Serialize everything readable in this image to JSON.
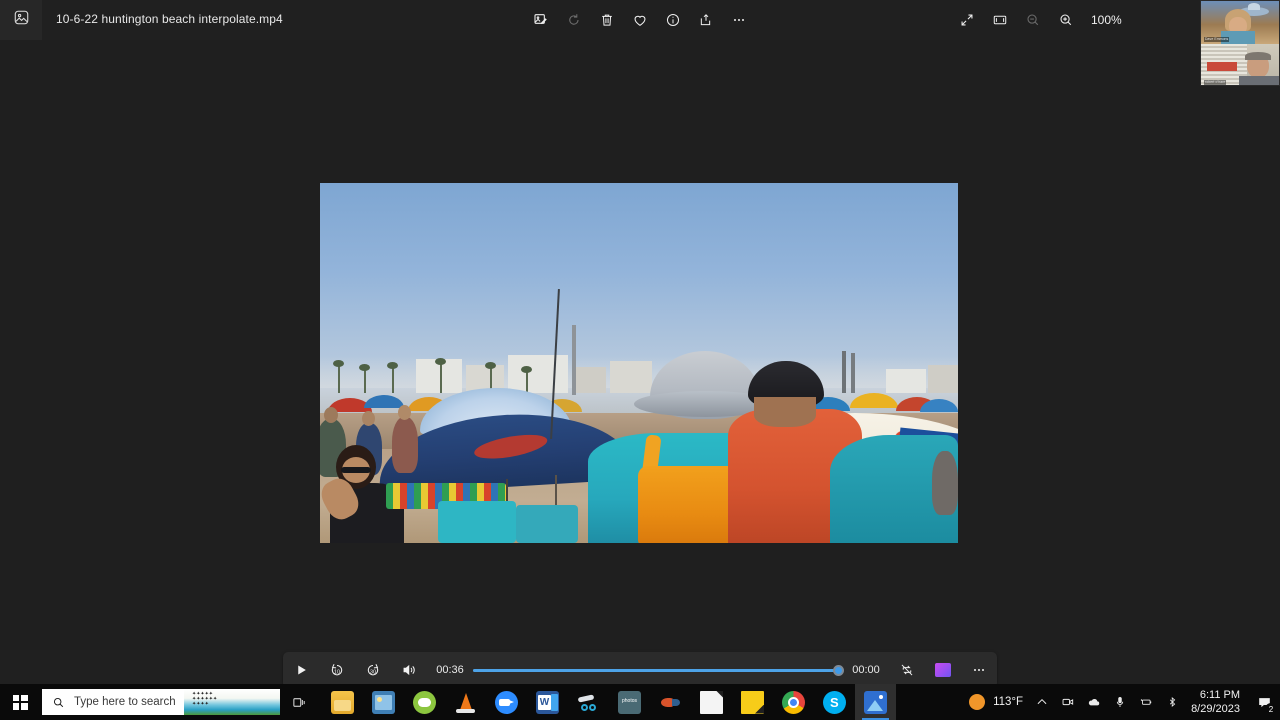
{
  "window": {
    "app_icon": "photo-collection-icon",
    "title": "10-6-22 huntington beach interpolate.mp4",
    "minimize_label": "—"
  },
  "toolbar": {
    "center_items": [
      {
        "name": "edit-image-icon",
        "label": "Edit image",
        "dimmed": false
      },
      {
        "name": "rotate-icon",
        "label": "Rotate",
        "dimmed": true
      },
      {
        "name": "delete-icon",
        "label": "Delete",
        "dimmed": false
      },
      {
        "name": "favorite-icon",
        "label": "Add to favorites",
        "dimmed": false
      },
      {
        "name": "info-icon",
        "label": "File info",
        "dimmed": false
      },
      {
        "name": "share-icon",
        "label": "Share",
        "dimmed": false
      },
      {
        "name": "more-options-icon",
        "label": "See more",
        "dimmed": false
      }
    ],
    "right_items": [
      {
        "name": "fullscreen-icon",
        "label": "Full screen",
        "dimmed": false
      },
      {
        "name": "fit-to-window-icon",
        "label": "Fit to window",
        "dimmed": false
      },
      {
        "name": "zoom-out-icon",
        "label": "Zoom out",
        "dimmed": true
      },
      {
        "name": "zoom-in-icon",
        "label": "Zoom in",
        "dimmed": false
      }
    ],
    "zoom_level": "100%"
  },
  "player": {
    "play_label": "Play",
    "rewind_label": "10",
    "forward_label": "30",
    "volume_label": "Volume",
    "elapsed_time": "00:36",
    "remaining_time": "00:00",
    "progress_percent": 99,
    "loop_label": "Repeat off",
    "cast_label": "Cast to device",
    "more_label": "More options"
  },
  "media": {
    "kind": "video-frame",
    "scene": "crowded beach with umbrellas and people",
    "sky_top_color": "#7ea6d2",
    "sky_bottom_color": "#c6d2dd",
    "sand_color": "#b9a188",
    "umbrella_navy": "#243f72",
    "shirt_teal": "#27a8bc",
    "shirt_orange": "#d4532f",
    "backpack_orange": "#e88b12"
  },
  "video_call": {
    "app": "zoom-meeting-overlay",
    "participants": [
      {
        "name_label": "Dave Emmons"
      },
      {
        "name_label": "robert o'hare"
      }
    ]
  },
  "taskbar": {
    "start_label": "Start",
    "search": {
      "placeholder": "Type here to search",
      "icon": "search-icon"
    },
    "task_view_label": "Task View",
    "apps": [
      {
        "name": "file-explorer",
        "label": "File Explorer",
        "active": false
      },
      {
        "name": "photo-viewer",
        "label": "Photo Viewer",
        "active": false
      },
      {
        "name": "green-cloud-app",
        "label": "Backup App",
        "active": false
      },
      {
        "name": "vlc-media-player",
        "label": "VLC media player",
        "active": false
      },
      {
        "name": "zoom-app",
        "label": "Zoom",
        "active": false
      },
      {
        "name": "microsoft-word",
        "label": "Word",
        "active": false
      },
      {
        "name": "snipping-tool",
        "label": "Snipping Tool",
        "active": false
      },
      {
        "name": "amazon-photos",
        "label": "Amazon Photos",
        "active": false
      },
      {
        "name": "fish-app",
        "label": "Media App",
        "active": false
      },
      {
        "name": "document-app",
        "label": "Document",
        "active": false
      },
      {
        "name": "sticky-notes",
        "label": "Sticky Notes",
        "active": false
      },
      {
        "name": "google-chrome",
        "label": "Google Chrome",
        "active": false
      },
      {
        "name": "skype",
        "label": "Skype",
        "active": false
      },
      {
        "name": "photos-app",
        "label": "Photos",
        "active": true
      }
    ],
    "tray": {
      "weather_temp": "113°F",
      "weather_icon": "sun-icon",
      "show_hidden_icons_label": "Show hidden icons",
      "icons": [
        {
          "name": "camera-icon",
          "label": "Camera"
        },
        {
          "name": "onedrive-cloud-icon",
          "label": "OneDrive"
        },
        {
          "name": "microphone-icon",
          "label": "Microphone in use"
        },
        {
          "name": "battery-icon",
          "label": "Battery"
        },
        {
          "name": "bluetooth-icon",
          "label": "Bluetooth"
        }
      ],
      "time": "6:11 PM",
      "date": "8/29/2023",
      "notification_count": "2",
      "notification_label": "Notifications"
    }
  }
}
